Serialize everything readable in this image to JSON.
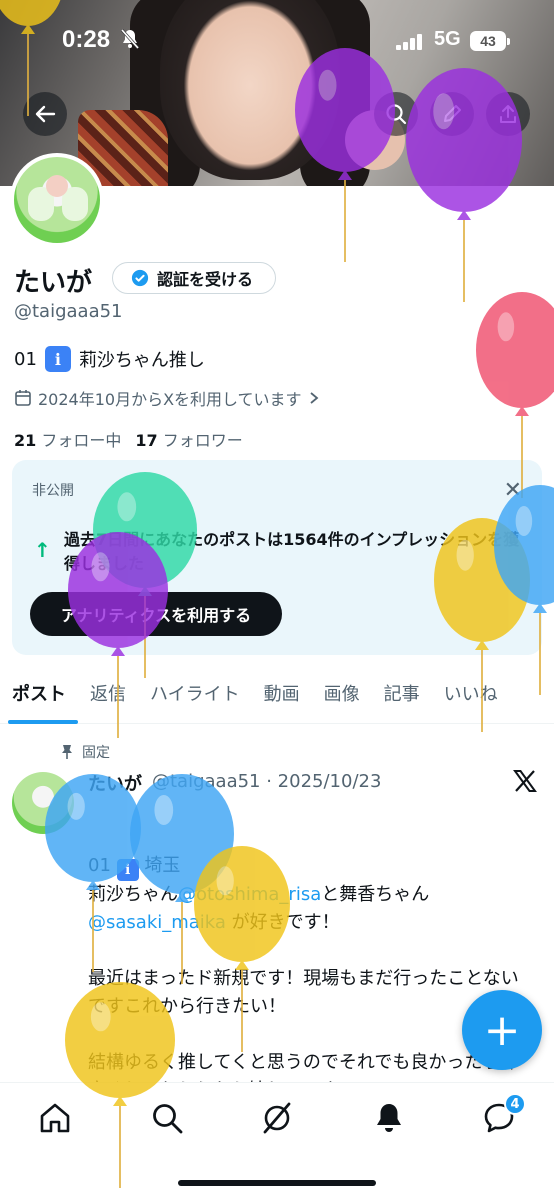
{
  "status_bar": {
    "time": "0:28",
    "network": "5G",
    "battery": "43"
  },
  "profile": {
    "name": "たいが",
    "verify_button": "認証を受ける",
    "handle": "@taigaaa51",
    "bio_prefix": "01",
    "bio_icon": "ℹ",
    "bio_text": "莉沙ちゃん推し",
    "joined": "2024年10月からXを利用しています",
    "following_count": "21",
    "following_label": "フォロー中",
    "followers_count": "17",
    "followers_label": "フォロワー"
  },
  "analytics_card": {
    "private_label": "非公開",
    "text": "過去7日間にあなたのポストは1564件のインプレッションを獲得しました",
    "button": "アナリティクスを利用する"
  },
  "tabs": [
    "ポスト",
    "返信",
    "ハイライト",
    "動画",
    "画像",
    "記事",
    "いいね"
  ],
  "post": {
    "pinned_label": "固定",
    "name": "たいが",
    "meta": "@taigaaa51 · 2025/10/23",
    "line1_prefix": "01",
    "line1_icon": "ℹ",
    "line1_text": "埼玉",
    "line2_a": "莉沙ちゃん",
    "line2_mention": "@otoshima_risa",
    "line2_b": "と舞香ちゃん",
    "line3_mention": "@sasaki_maika",
    "line3_b": " が好きです！",
    "para2": "最近はまったド新規です！現場もまだ行ったことないですこれから行きたい！",
    "para3": "結構ゆるく推してくと思うのでそれでも良かったら仲良くしてもらえたら嬉しいです！"
  },
  "fab": "+",
  "bottom_nav": {
    "message_badge": "4"
  },
  "icons": [
    "back-arrow-icon",
    "search-icon",
    "edit-icon",
    "share-icon",
    "verified-badge-icon",
    "calendar-icon",
    "chevron-right-icon",
    "close-icon",
    "arrow-up-icon",
    "pin-icon",
    "x-logo-icon",
    "home-icon",
    "grok-icon",
    "bell-icon",
    "message-icon",
    "mute-bell-icon",
    "signal-icon"
  ],
  "colors": {
    "accent": "#1d9bf0",
    "text": "#0f1419",
    "secondary": "#536471",
    "card_bg": "#eaf6fb"
  }
}
